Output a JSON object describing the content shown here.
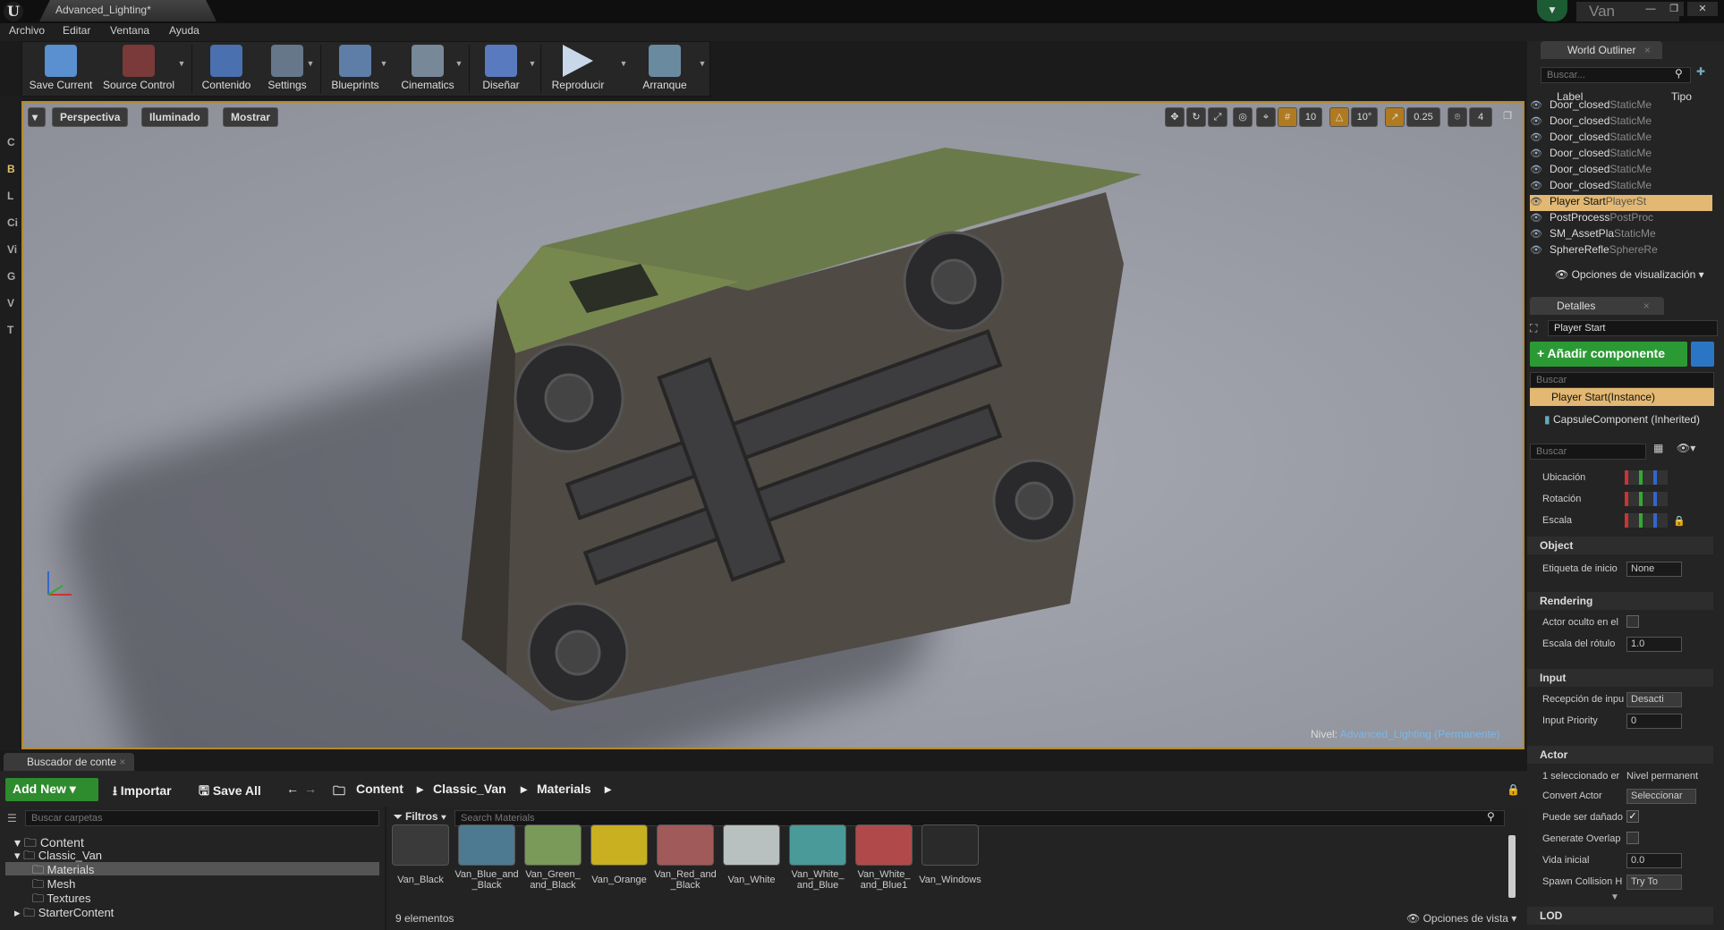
{
  "window": {
    "doc_tab": "Advanced_Lighting*",
    "project": "Van",
    "min": "—",
    "max": "❐",
    "close": "✕"
  },
  "menu": [
    "Archivo",
    "Editar",
    "Ventana",
    "Ayuda"
  ],
  "toolbar": [
    {
      "label": "Save Current",
      "icon": "save-icon",
      "color": "#5a8fd0"
    },
    {
      "label": "Source Control",
      "icon": "source-control-icon",
      "color": "#c04040"
    },
    {
      "label": "Contenido",
      "icon": "content-icon",
      "color": "#4a70b0"
    },
    {
      "label": "Settings",
      "icon": "settings-icon",
      "color": "#8899aa"
    },
    {
      "label": "Blueprints",
      "icon": "blueprints-icon",
      "color": "#7a9ac0"
    },
    {
      "label": "Cinematics",
      "icon": "cinematics-icon",
      "color": "#9aa"
    },
    {
      "label": "Diseñar",
      "icon": "design-icon",
      "color": "#6a8ac8"
    },
    {
      "label": "Reproducir",
      "icon": "play-icon",
      "color": "#bcd"
    },
    {
      "label": "Arranque",
      "icon": "launch-icon",
      "color": "#8ab"
    }
  ],
  "left_strip": [
    "C",
    "B",
    "L",
    "Ci",
    "Vi",
    "G",
    "V",
    "T"
  ],
  "viewport": {
    "perspective": "Perspectiva",
    "lit": "Iluminado",
    "show": "Mostrar",
    "grid_snap": "10",
    "rot_snap": "10°",
    "scale_snap": "0.25",
    "cam_speed": "4",
    "level_prefix": "Nivel:",
    "level_name": "Advanced_Lighting (Permanente)"
  },
  "outliner": {
    "tab": "World Outliner",
    "search_placeholder": "Buscar...",
    "col_label": "Label",
    "col_type": "Tipo",
    "rows": [
      {
        "label": "Door_closed",
        "type": "StaticMe"
      },
      {
        "label": "Door_closed",
        "type": "StaticMe"
      },
      {
        "label": "Door_closed",
        "type": "StaticMe"
      },
      {
        "label": "Door_closed",
        "type": "StaticMe"
      },
      {
        "label": "Door_closed",
        "type": "StaticMe"
      },
      {
        "label": "Door_closed",
        "type": "StaticMe"
      },
      {
        "label": "Player Start",
        "type": "PlayerSt"
      },
      {
        "label": "PostProcess",
        "type": "PostProc"
      },
      {
        "label": "SM_AssetPla",
        "type": "StaticMe"
      },
      {
        "label": "SphereRefle",
        "type": "SphereRe"
      }
    ],
    "view_options": "Opciones de visualización"
  },
  "details": {
    "tab": "Detalles",
    "actor_name": "Player Start",
    "add_component": "+ Añadir componente",
    "search_placeholder": "Buscar",
    "instance": "Player Start(Instance)",
    "capsule": "CapsuleComponent (Inherited)",
    "search2_placeholder": "Buscar",
    "transform": {
      "location": "Ubicación",
      "rotation": "Rotación",
      "scale": "Escala"
    },
    "sections": {
      "object": "Object",
      "rendering": "Rendering",
      "input": "Input",
      "actor": "Actor",
      "lod": "LOD"
    },
    "props": {
      "tag_label": "Etiqueta de inicio",
      "tag_value": "None",
      "hidden_label": "Actor oculto en el",
      "billboard_label": "Escala del rótulo",
      "billboard_value": "1.0",
      "receive_label": "Recepción de inpu",
      "receive_value": "Desacti",
      "priority_label": "Input Priority",
      "priority_value": "0",
      "selected_label": "1 seleccionado er",
      "selected_value": "Nivel permanent",
      "convert_label": "Convert Actor",
      "convert_value": "Seleccionar",
      "damage_label": "Puede ser dañado",
      "overlap_label": "Generate Overlap",
      "life_label": "Vida inicial",
      "life_value": "0.0",
      "spawn_label": "Spawn Collision H",
      "spawn_value": "Try To"
    }
  },
  "content_browser": {
    "tab": "Buscador de conte",
    "add_new": "Add New",
    "import": "Importar",
    "save_all": "Save All",
    "path": [
      "Content",
      "Classic_Van",
      "Materials"
    ],
    "folder_search": "Buscar carpetas",
    "filters": "Filtros",
    "asset_search": "Search Materials",
    "tree": [
      {
        "label": "Content",
        "level": 0
      },
      {
        "label": "Classic_Van",
        "level": 1
      },
      {
        "label": "Materials",
        "level": 2
      },
      {
        "label": "Mesh",
        "level": 2
      },
      {
        "label": "Textures",
        "level": 2
      },
      {
        "label": "StarterContent",
        "level": 1
      }
    ],
    "assets": [
      {
        "line1": "Van_Black",
        "line2": "",
        "color": "#3a3a3a"
      },
      {
        "line1": "Van_Blue_and",
        "line2": "_Black",
        "color": "#4d7a90"
      },
      {
        "line1": "Van_Green_",
        "line2": "and_Black",
        "color": "#7a9a5a"
      },
      {
        "line1": "Van_Orange",
        "line2": "",
        "color": "#c8b020"
      },
      {
        "line1": "Van_Red_and",
        "line2": "_Black",
        "color": "#a05a5a"
      },
      {
        "line1": "Van_White",
        "line2": "",
        "color": "#b8c0c0"
      },
      {
        "line1": "Van_White_",
        "line2": "and_Blue",
        "color": "#4a9a9a"
      },
      {
        "line1": "Van_White_",
        "line2": "and_Blue1",
        "color": "#b04a4a"
      },
      {
        "line1": "Van_Windows",
        "line2": "",
        "color": "#2a2a2a"
      }
    ],
    "count": "9 elementos",
    "view_options": "Opciones de vista"
  }
}
